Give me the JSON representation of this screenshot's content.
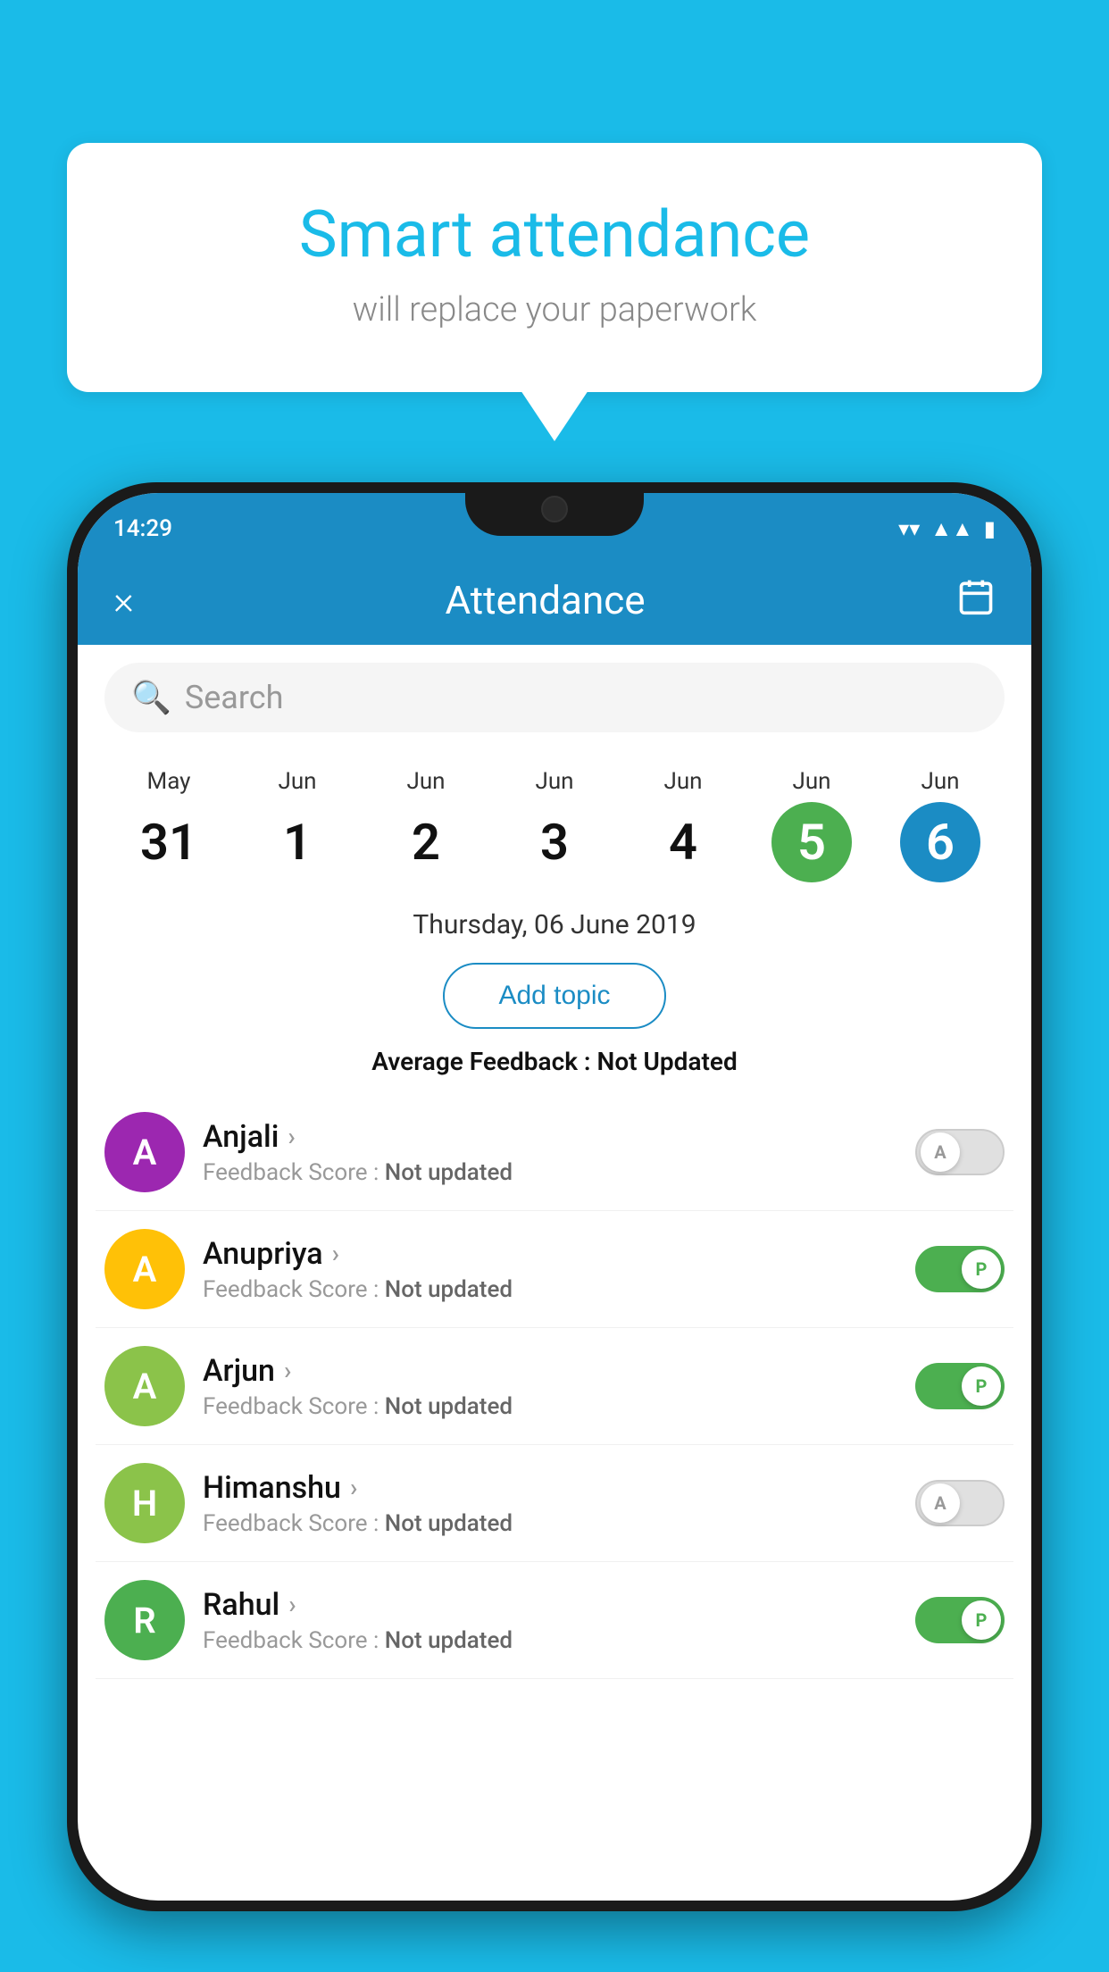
{
  "page": {
    "background_color": "#1ABBE8"
  },
  "speech_bubble": {
    "title": "Smart attendance",
    "subtitle": "will replace your paperwork"
  },
  "status_bar": {
    "time": "14:29",
    "icons": [
      "wifi",
      "signal",
      "battery"
    ]
  },
  "header": {
    "title": "Attendance",
    "close_label": "×",
    "calendar_icon": "📅"
  },
  "search": {
    "placeholder": "Search"
  },
  "dates": [
    {
      "month": "May",
      "day": "31",
      "state": "normal"
    },
    {
      "month": "Jun",
      "day": "1",
      "state": "normal"
    },
    {
      "month": "Jun",
      "day": "2",
      "state": "normal"
    },
    {
      "month": "Jun",
      "day": "3",
      "state": "normal"
    },
    {
      "month": "Jun",
      "day": "4",
      "state": "normal"
    },
    {
      "month": "Jun",
      "day": "5",
      "state": "today"
    },
    {
      "month": "Jun",
      "day": "6",
      "state": "selected"
    }
  ],
  "selected_date": "Thursday, 06 June 2019",
  "add_topic_label": "Add topic",
  "average_feedback_label": "Average Feedback :",
  "average_feedback_value": "Not Updated",
  "students": [
    {
      "name": "Anjali",
      "initial": "A",
      "avatar_color": "#9C27B0",
      "feedback_label": "Feedback Score :",
      "feedback_value": "Not updated",
      "toggle_state": "off",
      "toggle_label": "A"
    },
    {
      "name": "Anupriya",
      "initial": "A",
      "avatar_color": "#FFC107",
      "feedback_label": "Feedback Score :",
      "feedback_value": "Not updated",
      "toggle_state": "on",
      "toggle_label": "P"
    },
    {
      "name": "Arjun",
      "initial": "A",
      "avatar_color": "#8BC34A",
      "feedback_label": "Feedback Score :",
      "feedback_value": "Not updated",
      "toggle_state": "on",
      "toggle_label": "P"
    },
    {
      "name": "Himanshu",
      "initial": "H",
      "avatar_color": "#8BC34A",
      "feedback_label": "Feedback Score :",
      "feedback_value": "Not updated",
      "toggle_state": "off",
      "toggle_label": "A"
    },
    {
      "name": "Rahul",
      "initial": "R",
      "avatar_color": "#4CAF50",
      "feedback_label": "Feedback Score :",
      "feedback_value": "Not updated",
      "toggle_state": "on",
      "toggle_label": "P"
    }
  ]
}
